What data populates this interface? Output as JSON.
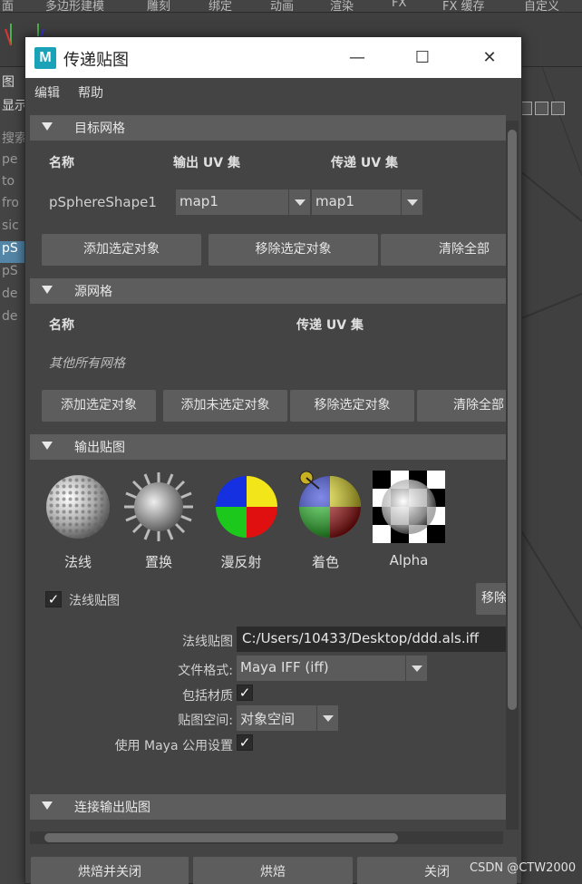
{
  "background_app": {
    "menu_items": [
      "面",
      "多边形建模",
      "雕刻",
      "绑定",
      "动画",
      "渲染",
      "FX",
      "FX 缓存",
      "自定义"
    ],
    "outliner_rows": [
      "图",
      "显示",
      "搜索...",
      "pe",
      "to",
      "fro",
      "sic",
      "pS",
      "pS",
      "de",
      "de"
    ]
  },
  "dialog": {
    "title": "传递贴图",
    "app_icon_letter": "M",
    "menu": {
      "edit": "编辑",
      "help": "帮助"
    },
    "target_mesh": {
      "section_title": "目标网格",
      "col_name": "名称",
      "col_output_uv": "输出 UV 集",
      "col_transfer_uv": "传递 UV 集",
      "row": {
        "name": "pSphereShape1",
        "output_uv": "map1",
        "transfer_uv": "map1"
      },
      "buttons": {
        "add_selected": "添加选定对象",
        "remove_selected": "移除选定对象",
        "clear_all": "清除全部"
      }
    },
    "source_mesh": {
      "section_title": "源网格",
      "col_name": "名称",
      "col_transfer_uv": "传递 UV 集",
      "note": "其他所有网格",
      "buttons": {
        "add_selected": "添加选定对象",
        "add_unselected": "添加未选定对象",
        "remove_selected": "移除选定对象",
        "clear_all": "清除全部"
      }
    },
    "output_maps": {
      "section_title": "输出贴图",
      "swatches": {
        "normal": "法线",
        "displacement": "置换",
        "diffuse": "漫反射",
        "shaded": "着色",
        "alpha": "Alpha"
      },
      "normal_map_checkbox_label": "法线贴图",
      "normal_map_checked": true,
      "remove_button": "移除",
      "normal_map_label": "法线贴图",
      "normal_map_path": "C:/Users/10433/Desktop/ddd.als.iff",
      "file_format_label": "文件格式:",
      "file_format_value": "Maya IFF (iff)",
      "include_material_label": "包括材质",
      "include_material_checked": true,
      "map_space_label": "贴图空间:",
      "map_space_value": "对象空间",
      "maya_common_label": "使用 Maya 公用设置",
      "maya_common_checked": true
    },
    "connect_output": {
      "section_title": "连接输出贴图"
    },
    "bottom_buttons": {
      "bake_close": "烘焙并关闭",
      "bake": "烘焙",
      "close": "关闭"
    }
  },
  "watermark": "CSDN @CTW2000"
}
